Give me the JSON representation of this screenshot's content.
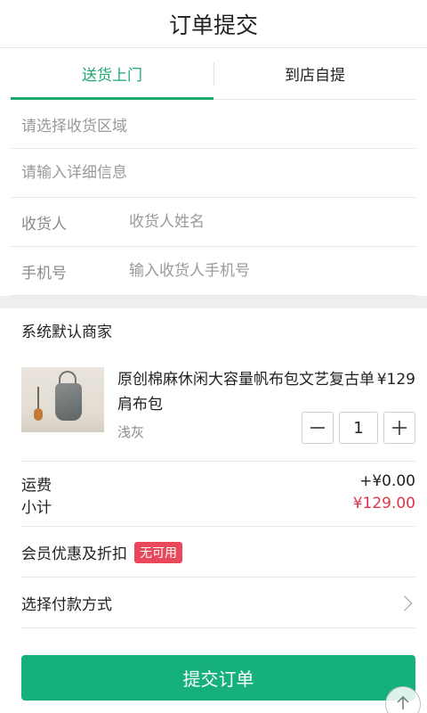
{
  "header": {
    "title": "订单提交"
  },
  "tabs": [
    {
      "label": "送货上门",
      "active": true
    },
    {
      "label": "到店自提",
      "active": false
    }
  ],
  "form": {
    "region_placeholder": "请选择收货区域",
    "detail_placeholder": "请输入详细信息",
    "receiver_label": "收货人",
    "receiver_placeholder": "收货人姓名",
    "phone_label": "手机号",
    "phone_placeholder": "输入收货人手机号"
  },
  "merchant": {
    "name": "系统默认商家"
  },
  "product": {
    "name": "原创棉麻休闲大容量帆布包文艺复古单肩布包",
    "price": "¥129",
    "color": "浅灰",
    "quantity": "1",
    "minus_icon": "minus-icon",
    "plus_icon": "plus-icon"
  },
  "fees": {
    "shipping_label": "运费",
    "shipping_value": "+¥0.00",
    "subtotal_label": "小计",
    "subtotal_value": "¥129.00"
  },
  "discount": {
    "label": "会员优惠及折扣",
    "badge": "无可用"
  },
  "payment": {
    "label": "选择付款方式",
    "icon": "chevron-right-icon"
  },
  "submit": {
    "label": "提交订单"
  },
  "colors": {
    "accent": "#16b07c",
    "tab_active": "#1aaa6f",
    "price_red": "#e0344c",
    "badge_red": "#e8485a"
  }
}
